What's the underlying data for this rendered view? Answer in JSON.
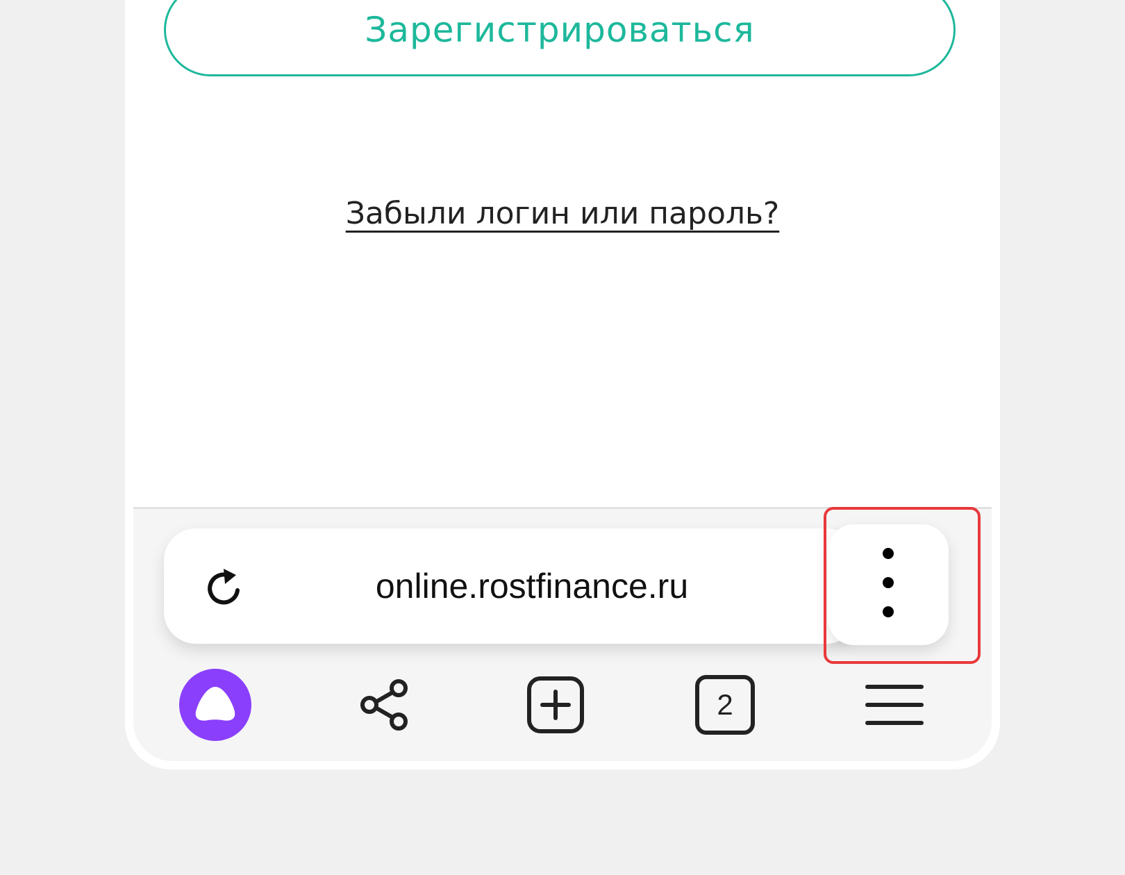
{
  "page": {
    "register_label": "Зарегистрироваться",
    "forgot_label": "Забыли логин или пароль?"
  },
  "browser": {
    "url": "online.rostfinance.ru",
    "tab_count": "2"
  },
  "icons": {
    "reload": "reload-icon",
    "more": "more-vertical-icon",
    "assistant": "alice-assistant-icon",
    "share": "share-icon",
    "new_tab": "new-tab-icon",
    "tabs": "tabs-counter-icon",
    "menu": "hamburger-menu-icon"
  },
  "colors": {
    "accent": "#1db89b",
    "assistant": "#8a3ffc",
    "highlight": "#e8393b"
  }
}
